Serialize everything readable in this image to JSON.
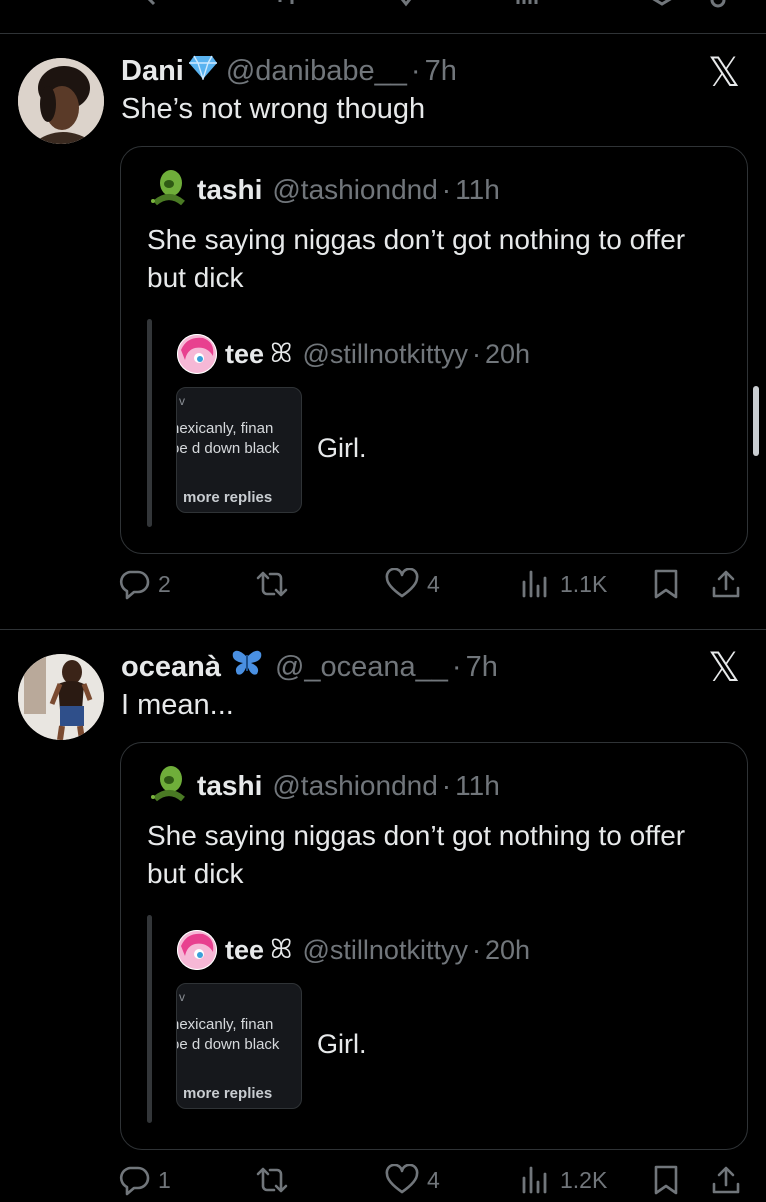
{
  "posts": [
    {
      "author_name": "Dani",
      "handle": "@danibabe__",
      "time": "7h",
      "badge": "diamond",
      "text": "She’s not wrong though",
      "quote": {
        "name": "tashi",
        "handle": "@tashiondnd",
        "time": "11h",
        "text": "She saying niggas don’t got nothing to offer but dick",
        "nested": {
          "name": "tee",
          "name_suffix": "ꕤ",
          "handle": "@stillnotkittyy",
          "time": "20h",
          "screenshot_lines": [
            "nexicanly, finan",
            "oe d down black"
          ],
          "screenshot_corner": "v",
          "screenshot_footer": "more replies",
          "text": "Girl."
        }
      },
      "stats": {
        "replies": "2",
        "reposts": "",
        "likes": "4",
        "views": "1.1K"
      }
    },
    {
      "author_name": "oceanà",
      "handle": "@_oceana__",
      "time": "7h",
      "badge": "butterfly",
      "text": "I mean...",
      "quote": {
        "name": "tashi",
        "handle": "@tashiondnd",
        "time": "11h",
        "text": "She saying niggas don’t got nothing to offer but dick",
        "nested": {
          "name": "tee",
          "name_suffix": "ꕤ",
          "handle": "@stillnotkittyy",
          "time": "20h",
          "screenshot_lines": [
            "nexicanly, finan",
            "oe d down black"
          ],
          "screenshot_corner": "v",
          "screenshot_footer": "more replies",
          "text": "Girl."
        }
      },
      "stats": {
        "replies": "1",
        "reposts": "",
        "likes": "4",
        "views": "1.2K"
      }
    }
  ],
  "ui": {
    "close_glyph": "𝕏",
    "dot": "·"
  },
  "colors": {
    "background": "#000000",
    "text": "#e7e9ea",
    "muted": "#71767b",
    "border": "#2f3336",
    "diamond": "#5ab3f0",
    "butterfly": "#4a90e2"
  },
  "icons": [
    "reply-icon",
    "repost-icon",
    "like-icon",
    "views-icon",
    "bookmark-icon",
    "share-icon",
    "diamond-badge-icon",
    "butterfly-badge-icon",
    "x-logo-icon"
  ]
}
